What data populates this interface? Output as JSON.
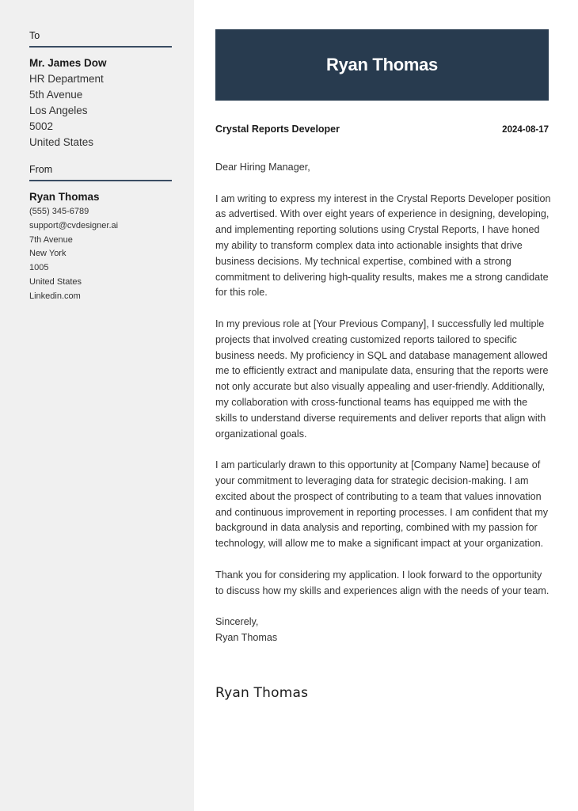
{
  "recipient": {
    "heading": "To",
    "name": "Mr. James Dow",
    "lines": [
      "HR Department",
      "5th Avenue",
      "Los Angeles",
      "5002",
      "United States"
    ]
  },
  "sender": {
    "heading": "From",
    "name": "Ryan Thomas",
    "lines": [
      "(555) 345-6789",
      "support@cvdesigner.ai",
      "7th Avenue",
      "New York",
      "1005",
      "United States",
      "Linkedin.com"
    ]
  },
  "header": {
    "name": "Ryan Thomas",
    "background_color": "#283b4f"
  },
  "meta": {
    "job_title": "Crystal Reports Developer",
    "date": "2024-08-17"
  },
  "letter": {
    "greeting": "Dear Hiring Manager,",
    "paragraphs": [
      "I am writing to express my interest in the Crystal Reports Developer position as advertised. With over eight years of experience in designing, developing, and implementing reporting solutions using Crystal Reports, I have honed my ability to transform complex data into actionable insights that drive business decisions. My technical expertise, combined with a strong commitment to delivering high-quality results, makes me a strong candidate for this role.",
      "In my previous role at [Your Previous Company], I successfully led multiple projects that involved creating customized reports tailored to specific business needs. My proficiency in SQL and database management allowed me to efficiently extract and manipulate data, ensuring that the reports were not only accurate but also visually appealing and user-friendly. Additionally, my collaboration with cross-functional teams has equipped me with the skills to understand diverse requirements and deliver reports that align with organizational goals.",
      "I am particularly drawn to this opportunity at [Company Name] because of your commitment to leveraging data for strategic decision-making. I am excited about the prospect of contributing to a team that values innovation and continuous improvement in reporting processes. I am confident that my background in data analysis and reporting, combined with my passion for technology, will allow me to make a significant impact at your organization.",
      "Thank you for considering my application. I look forward to the opportunity to discuss how my skills and experiences align with the needs of your team."
    ],
    "closing": "Sincerely,",
    "closing_name": "Ryan Thomas",
    "signature": "Ryan Thomas"
  }
}
